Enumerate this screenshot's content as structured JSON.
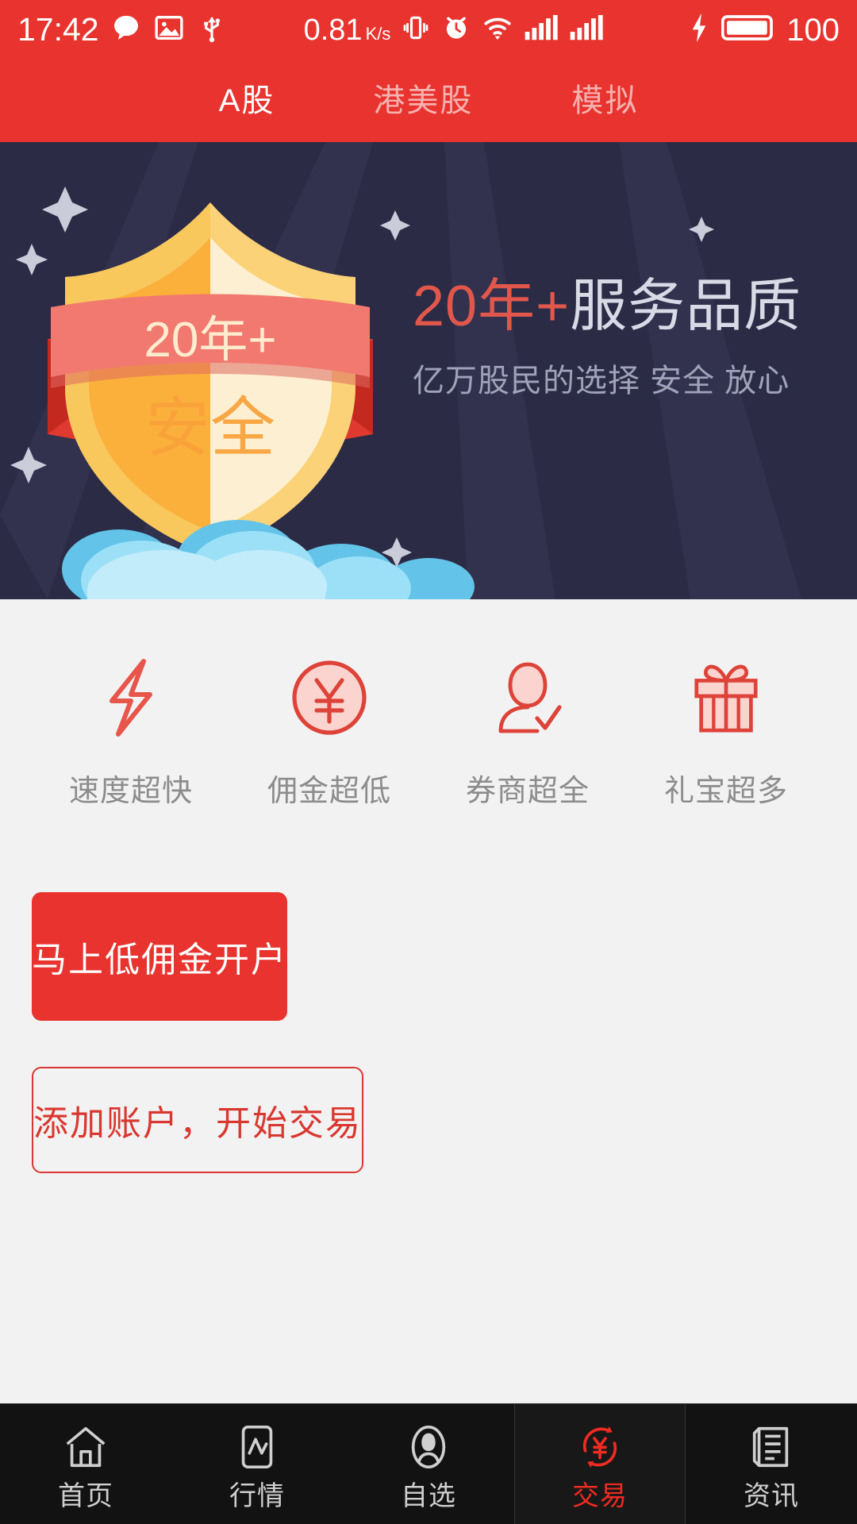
{
  "status_bar": {
    "time": "17:42",
    "network_speed": "0.81",
    "network_speed_unit": "K/s",
    "battery_level": "100",
    "icons": [
      "message-icon",
      "image-icon",
      "usb-icon",
      "vibrate-icon",
      "alarm-icon",
      "wifi-icon",
      "signal-icon",
      "signal-icon",
      "charging-bolt-icon",
      "battery-icon"
    ],
    "background_color": "#e8332e"
  },
  "top_tabs": {
    "items": [
      {
        "label": "A股",
        "active": true
      },
      {
        "label": "港美股",
        "active": false
      },
      {
        "label": "模拟",
        "active": false
      }
    ]
  },
  "banner": {
    "background_color": "#2b2b46",
    "shield": {
      "ribbon_text": "20年+",
      "body_text": "安全"
    },
    "headline_highlight": "20年+",
    "headline_rest": "服务品质",
    "subtitle": "亿万股民的选择 安全 放心",
    "highlight_color": "#e2574c"
  },
  "features": [
    {
      "icon": "lightning-bolt-icon",
      "label": "速度超快"
    },
    {
      "icon": "yen-circle-icon",
      "label": "佣金超低"
    },
    {
      "icon": "person-check-icon",
      "label": "券商超全"
    },
    {
      "icon": "gift-icon",
      "label": "礼宝超多"
    }
  ],
  "actions": {
    "primary_label": "马上低佣金开户",
    "secondary_label": "添加账户，开始交易",
    "primary_color": "#e8332e",
    "secondary_color": "#d9372f"
  },
  "bottom_nav": {
    "items": [
      {
        "icon": "home-icon",
        "label": "首页",
        "active": false
      },
      {
        "icon": "chart-icon",
        "label": "行情",
        "active": false
      },
      {
        "icon": "person-icon",
        "label": "自选",
        "active": false
      },
      {
        "icon": "yen-refresh-icon",
        "label": "交易",
        "active": true
      },
      {
        "icon": "news-icon",
        "label": "资讯",
        "active": false
      }
    ],
    "active_color": "#ee2b22"
  }
}
